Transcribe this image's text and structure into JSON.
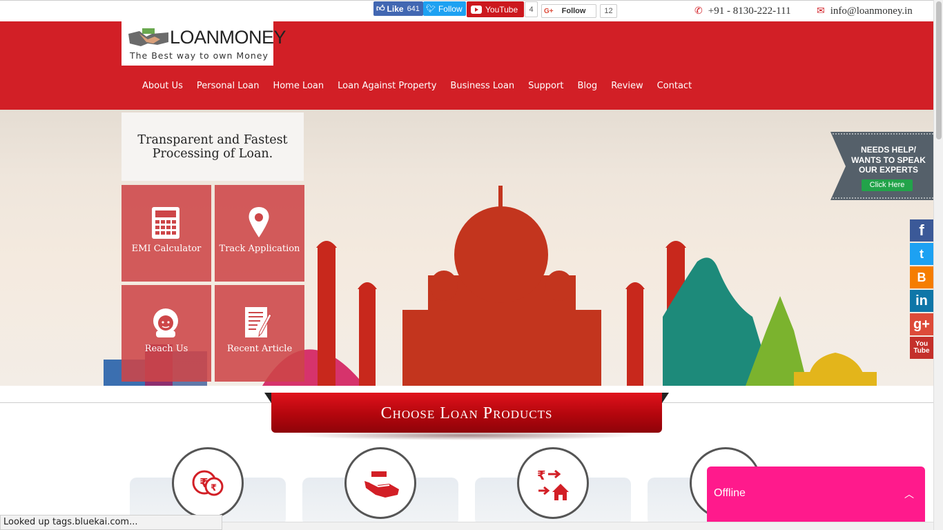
{
  "topbar": {
    "fb_like_label": "Like",
    "fb_like_count": "641",
    "twitter_label": "Follow",
    "youtube_label": "YouTube",
    "youtube_count": "4",
    "gplus_label": "Follow",
    "gplus_count": "12",
    "phone": "+91 - 8130-222-111",
    "email": "info@loanmoney.in"
  },
  "logo": {
    "brand": "LOANMONEY",
    "tagline": "The Best way to own Money"
  },
  "nav": [
    "About Us",
    "Personal Loan",
    "Home Loan",
    "Loan Against Property",
    "Business Loan",
    "Support",
    "Blog",
    "Review",
    "Contact"
  ],
  "hero": {
    "tagline": "Transparent and Fastest Processing of Loan.",
    "tiles": [
      {
        "label": "EMI Calculator",
        "icon": "calculator-icon"
      },
      {
        "label": "Track Application",
        "icon": "map-pin-icon"
      },
      {
        "label": "Reach Us",
        "icon": "support-agent-icon"
      },
      {
        "label": "Recent Article",
        "icon": "article-icon"
      }
    ],
    "help_text": "NEEDS HELP/ WANTS TO SPEAK OUR EXPERTS",
    "help_button": "Click Here"
  },
  "side_social": {
    "facebook": "f",
    "twitter": "t",
    "blogger": "B",
    "linkedin": "in",
    "googleplus": "g+",
    "youtube": "You Tube"
  },
  "products": {
    "heading": "Choose Loan Products",
    "items": [
      {
        "icon": "rupee-coins-icon"
      },
      {
        "icon": "hand-money-icon"
      },
      {
        "icon": "rupee-transfer-home-icon"
      },
      {
        "icon": "product-icon"
      }
    ]
  },
  "chat": {
    "status": "Offline"
  },
  "status_bar": {
    "text": "Looked up tags.bluekai.com..."
  },
  "colors": {
    "brand_red": "#d21f26",
    "tile_red": "#cd4648",
    "chat_pink": "#ff1a8c"
  }
}
